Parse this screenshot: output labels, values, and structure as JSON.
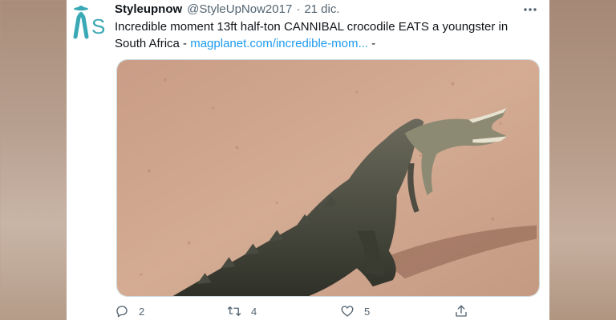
{
  "tweet": {
    "display_name": "Styleupnow",
    "handle": "@StyleUpNow2017",
    "separator": "·",
    "date": "21 dic.",
    "text_main": "Incredible moment 13ft half-ton CANNIBAL crocodile EATS a youngster in South Africa - ",
    "link_text": "magplanet.com/incredible-mom...",
    "text_tail": " -",
    "avatar_letters": "S"
  },
  "actions": {
    "reply_icon": "reply-icon",
    "reply_count": "2",
    "retweet_icon": "retweet-icon",
    "retweet_count": "4",
    "like_icon": "heart-icon",
    "like_count": "5",
    "share_icon": "share-icon"
  },
  "colors": {
    "accent": "#1d9bf0",
    "avatar_teal": "#3aa9b5",
    "text_primary": "#0f1419",
    "text_secondary": "#536471"
  }
}
